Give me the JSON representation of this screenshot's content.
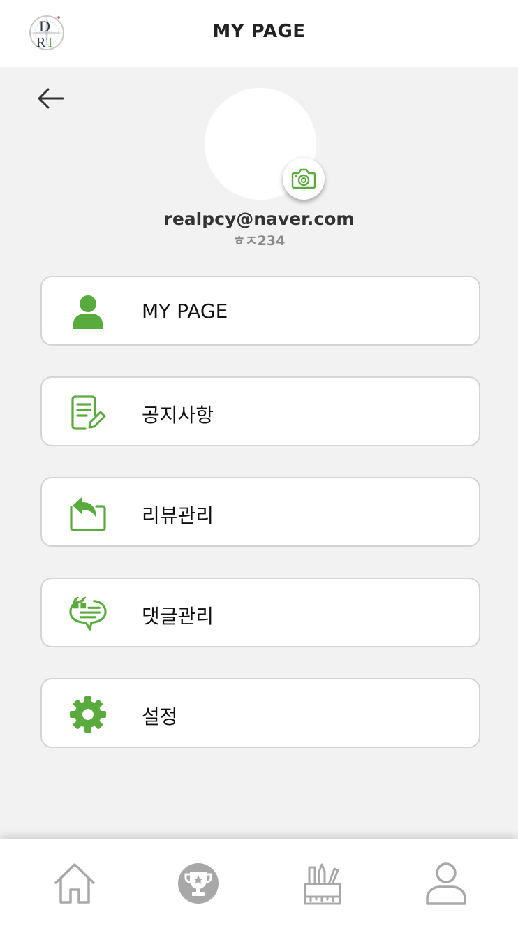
{
  "header": {
    "title": "MY PAGE",
    "logo_icon": "drt-compass-logo"
  },
  "profile": {
    "email": "realpcy@naver.com",
    "nickname": "ㅎㅈ234",
    "camera_icon": "camera-icon"
  },
  "menu": {
    "items": [
      {
        "label": "MY PAGE",
        "icon": "person-icon"
      },
      {
        "label": "공지사항",
        "icon": "notice-edit-icon"
      },
      {
        "label": "리뷰관리",
        "icon": "reply-box-icon"
      },
      {
        "label": "댓글관리",
        "icon": "comment-bubble-icon"
      },
      {
        "label": "설정",
        "icon": "gear-icon"
      }
    ]
  },
  "bottom_nav": {
    "items": [
      "home-icon",
      "trophy-icon",
      "pencil-cup-icon",
      "user-icon"
    ]
  },
  "colors": {
    "accent": "#5aab3d",
    "background": "#f2f2f2",
    "nav_icon": "#a8a8a8"
  }
}
